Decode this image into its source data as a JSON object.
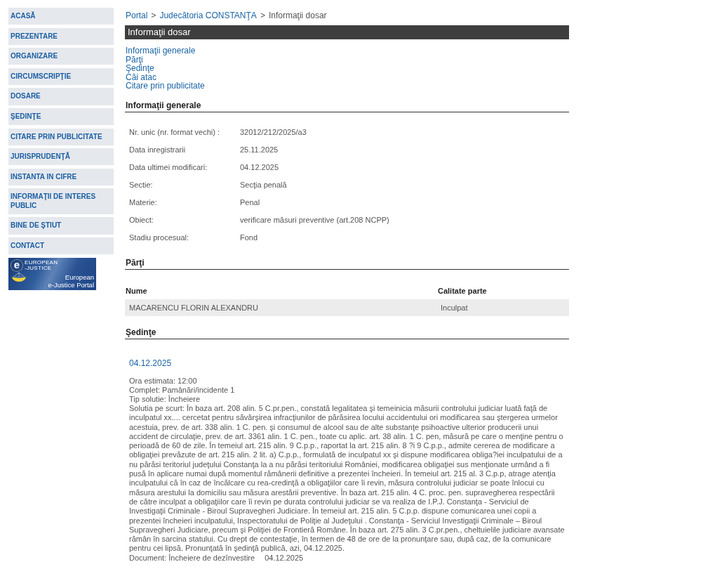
{
  "sidebar": {
    "items": [
      {
        "label": "ACASĂ"
      },
      {
        "label": "PREZENTARE"
      },
      {
        "label": "ORGANIZARE"
      },
      {
        "label": "CIRCUMSCRIPŢIE"
      },
      {
        "label": "DOSARE"
      },
      {
        "label": "ŞEDINŢE"
      },
      {
        "label": "CITARE PRIN PUBLICITATE"
      },
      {
        "label": "JURISPRUDENŢĂ"
      },
      {
        "label": "INSTANTA IN CIFRE"
      },
      {
        "label": "INFORMAŢII DE INTERES PUBLIC"
      },
      {
        "label": "BINE DE ŞTIUT"
      },
      {
        "label": "CONTACT"
      }
    ],
    "banner": {
      "logo_letter": "e",
      "logo_line_1": "EUROPEAN",
      "logo_line_2": "-JUSTICE",
      "caption_line_1": "European",
      "caption_line_2": "e-Justice Portal"
    }
  },
  "breadcrumb": [
    {
      "label": "Portal",
      "kind": "link"
    },
    {
      "separator": ">",
      "label": "Judecătoria CONSTANŢA",
      "kind": "link"
    },
    {
      "separator": ">",
      "label": "Informaţii dosar",
      "kind": "current"
    }
  ],
  "page_title": "Informaţii dosar",
  "section_links": [
    "Informaţii generale",
    "Părţi",
    "Şedinţe",
    "Căi atac",
    "Citare prin publicitate"
  ],
  "general_info": {
    "heading": "Informaţii generale",
    "rows": [
      {
        "label": "Nr. unic (nr. format vechi) :",
        "value": "32012/212/2025/a3"
      },
      {
        "label": "Data inregistrarii",
        "value": "25.11.2025"
      },
      {
        "label": "Data ultimei modificari:",
        "value": "04.12.2025"
      },
      {
        "label": "Sectie:",
        "value": "Secţia penală"
      },
      {
        "label": "Materie:",
        "value": "Penal"
      },
      {
        "label": "Obiect:",
        "value": "verificare măsuri preventive (art.208 NCPP)"
      },
      {
        "label": "Stadiu procesual:",
        "value": "Fond"
      }
    ]
  },
  "parties": {
    "heading": "Părţi",
    "table": {
      "columns": [
        "Nume",
        "Calitate parte"
      ],
      "rows": [
        [
          "MACARENCU FLORIN ALEXANDRU",
          "Inculpat"
        ]
      ]
    }
  },
  "hearings": {
    "heading": "Şedinţe",
    "items": [
      {
        "date": "04.12.2025",
        "details": [
          "Ora estimata: 12:00",
          "Complet: Pamânări/incidente 1",
          "Tip solutie: Încheiere"
        ],
        "summary": "Solutia pe scurt: În baza art. 208 alin. 5 C.pr.pen., constată legalitatea şi temeinicia măsurii controlului judiciar luată faţă de inculpatul xx.... cercetat pentru săvârşirea infracţiunilor de părăsirea locului accidentului ori modificarea sau ştergerea urmelor acestuia, prev. de art. 338 alin. 1 C. pen. şi consumul de alcool sau de alte substanţe psihoactive ulterior producerii unui accident de circulaţie, prev. de art. 3361 alin. 1 C. pen., toate cu aplic. art. 38 alin. 1 C. pen, măsură pe care o menţine pentru o perioadă de 60 de zile. În temeiul art. 215 alin. 9 C.p.p., raportat la art. 215 alin. 8 ?i 9 C.p.p., admite cererea de modificare a obligaţiei prevăzute de art. 215 alin. 2 lit. a) C.p.p., formulată de inculpatul xx şi dispune modificarea obliga?iei inculpatului de a nu părăsi teritoriul judeţului Constanţa la a nu părăsi teritoriului României, modificarea obligaţiei sus menţionate urmând a fi pusă în aplicare numai după momentul rămânerii definitive a prezentei încheieri. În temeiul art. 215 al. 3 C.p.p, atrage atenţia inculpatului că în caz de încălcare cu rea-credinţă a obligaţiilor care îi revin, măsura controlului judiciar se poate înlocui cu măsura arestului la domiciliu sau măsura arestării preventive. În baza art. 215 alin. 4 C. proc. pen. supravegherea respectării de către inculpat a obligaţiilor care îi revin pe durata controlului judiciar se va realiza de I.P.J. Constanţa - Serviciul de Investigaţii Criminale - Biroul Supravegheri Judiciare. În temeiul art. 215 alin. 5 C.p.p. dispune comunicarea unei copii a prezentei încheieri inculpatului, Inspectoratului de Poliţie al Judeţului . Constanţa - Serviciul Investigaţii Criminale – Biroul Supravegheri Judiciare, precum şi Poliţiei de Frontieră Române. În baza art. 275 alin. 3 C.pr.pen., cheltuielile judiciare avansate rămân în sarcina statului. Cu drept de contestaţie, în termen de 48 de ore de la pronunţare sau, după caz, de la comunicare pentru cei lipsă. Pronunţată în şedinţă publică, azi, 04.12.2025.",
        "document": {
          "label": "Document: Încheiere de dezînvestire",
          "date": "04.12.2025"
        }
      }
    ]
  }
}
